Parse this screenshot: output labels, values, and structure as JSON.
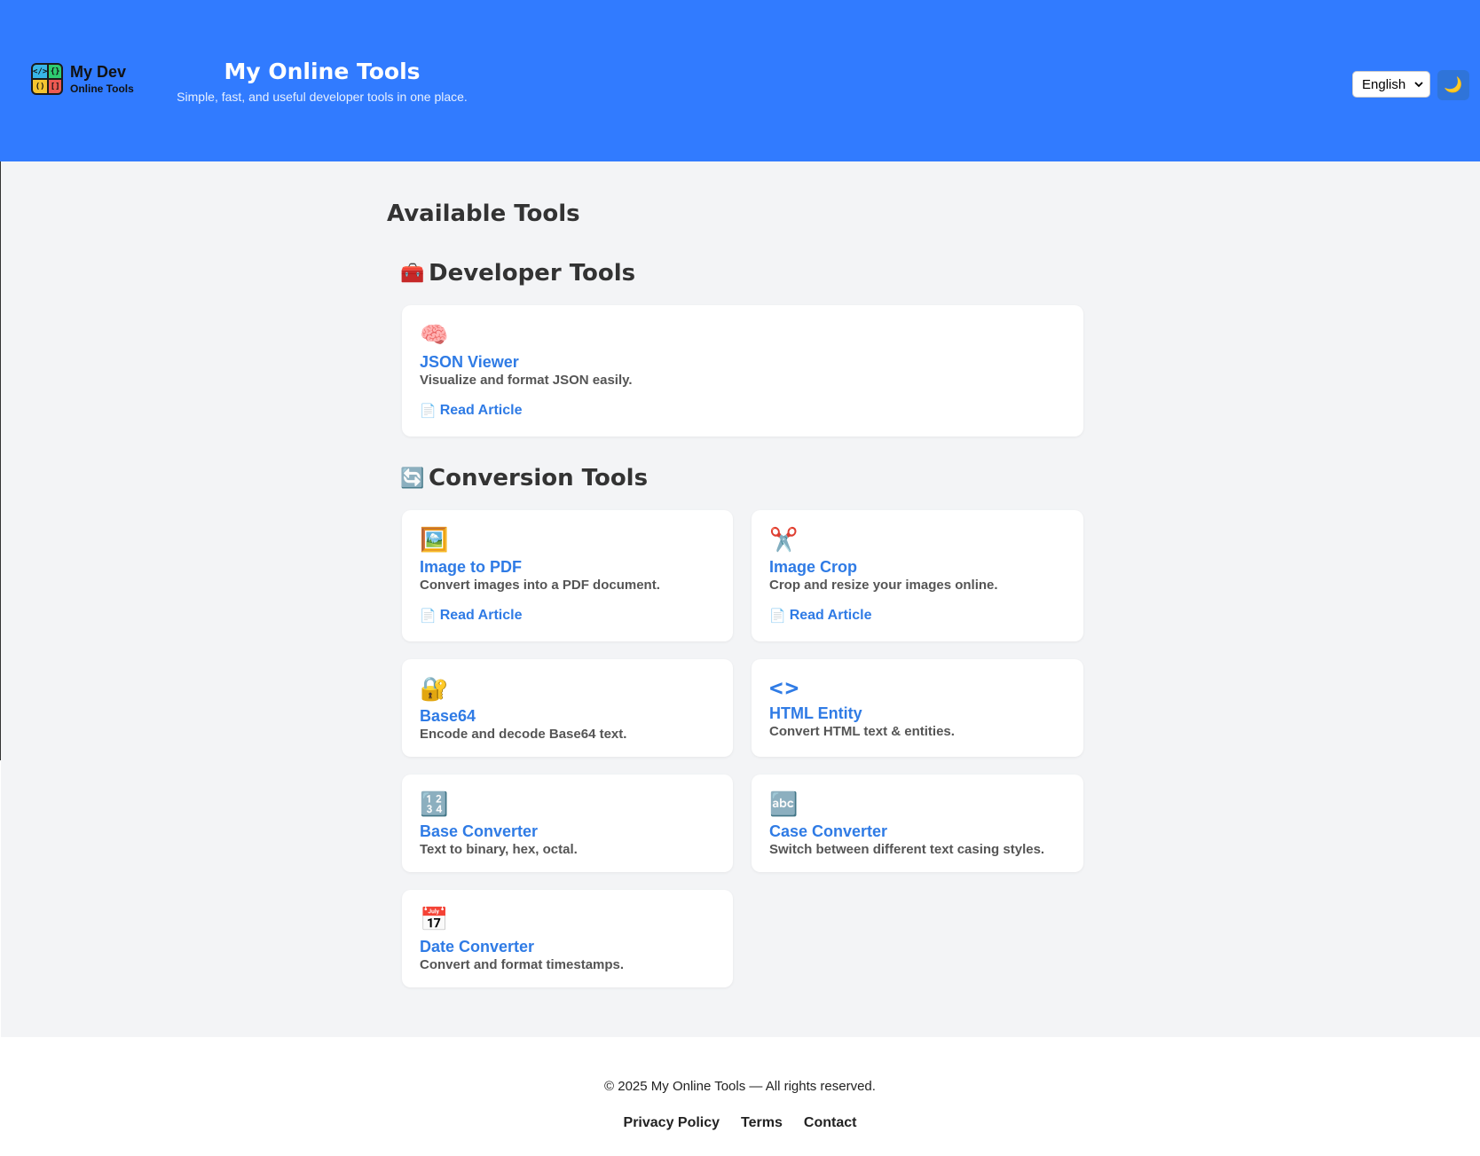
{
  "header": {
    "logo_line1": "My Dev",
    "logo_line2": "Online Tools",
    "logo_cells": [
      "</>",
      "{}",
      "()",
      "[]"
    ],
    "title": "My Online Tools",
    "subtitle": "Simple, fast, and useful developer tools in one place.",
    "language_selected": "English",
    "theme_icon": "moon-icon",
    "theme_glyph": "🌙",
    "brand_color": "#317bff"
  },
  "main": {
    "heading": "Available Tools",
    "sections": [
      {
        "heading": "Developer Tools",
        "icon": "toolbox-icon",
        "glyph": "🧰",
        "tools": [
          {
            "icon": "brain-icon",
            "glyph": "🧠",
            "title": "JSON Viewer",
            "desc": "Visualize and format JSON easily.",
            "link": "Read Article"
          }
        ]
      },
      {
        "heading": "Conversion Tools",
        "icon": "arrows-cycle-icon",
        "glyph": "🔄",
        "tools": [
          {
            "icon": "picture-icon",
            "glyph": "🖼️",
            "title": "Image to PDF",
            "desc": "Convert images into a PDF document.",
            "link": "Read Article"
          },
          {
            "icon": "scissors-icon",
            "glyph": "✂️",
            "title": "Image Crop",
            "desc": "Crop and resize your images online.",
            "link": "Read Article"
          },
          {
            "icon": "lock-key-icon",
            "glyph": "🔐",
            "title": "Base64",
            "desc": "Encode and decode Base64 text."
          },
          {
            "icon": "code-brackets-icon",
            "glyph": "<>",
            "title": "HTML Entity",
            "desc": "Convert HTML text & entities."
          },
          {
            "icon": "numbers-icon",
            "glyph": "🔢",
            "title": "Base Converter",
            "desc": "Text to binary, hex, octal."
          },
          {
            "icon": "abc-icon",
            "glyph": "🔤",
            "title": "Case Converter",
            "desc": "Switch between different text casing styles."
          },
          {
            "icon": "calendar-icon",
            "glyph": "📅",
            "title": "Date Converter",
            "desc": "Convert and format timestamps."
          }
        ]
      }
    ],
    "link_icon_glyph": "📄",
    "link_color": "#2f7be5"
  },
  "footer": {
    "copyright": "© 2025 My Online Tools — All rights reserved.",
    "links": [
      "Privacy Policy",
      "Terms",
      "Contact"
    ]
  }
}
